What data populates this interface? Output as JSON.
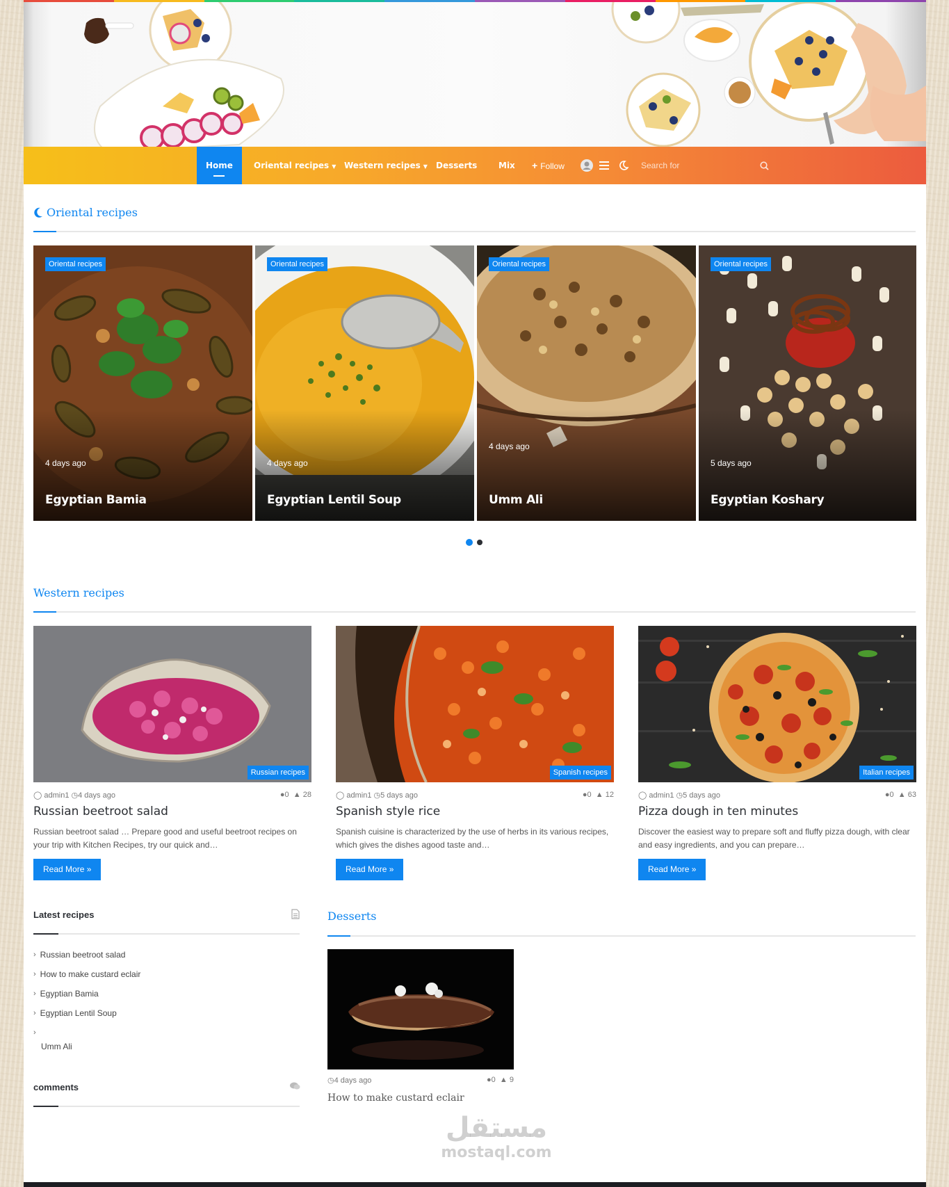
{
  "colors": {
    "accent": "#0f86f0",
    "nav_start": "#f6bf19",
    "nav_end": "#ec5b3e",
    "text": "#2c2f34",
    "strip": [
      "#e74c3c",
      "#f7ba1e",
      "#2ecc71",
      "#1abc9c",
      "#3498db",
      "#9b59b6",
      "#e91e63",
      "#ff9800",
      "#00bcd4",
      "#8e44ad"
    ]
  },
  "nav": {
    "items": [
      {
        "label": "Home",
        "active": true
      },
      {
        "label": "Oriental recipes",
        "dropdown": true
      },
      {
        "label": "Western recipes",
        "dropdown": true
      },
      {
        "label": "Desserts"
      },
      {
        "label": "Mix"
      }
    ],
    "follow_label": "Follow",
    "search_placeholder": "Search for",
    "icons": [
      "plus-icon",
      "user-avatar-icon",
      "menu-icon",
      "moon-icon",
      "search-icon"
    ]
  },
  "oriental": {
    "heading": "Oriental recipes",
    "slides": [
      {
        "category": "Oriental recipes",
        "date": "4 days ago",
        "title": "Egyptian Bamia"
      },
      {
        "category": "Oriental recipes",
        "date": "4 days ago",
        "title": "Egyptian Lentil Soup"
      },
      {
        "category": "Oriental recipes",
        "date": "4 days ago",
        "title": "Umm Ali"
      },
      {
        "category": "Oriental recipes",
        "date": "5 days ago",
        "title": "Egyptian Koshary"
      }
    ],
    "pager": {
      "pages": 2,
      "current": 1
    }
  },
  "western": {
    "heading": "Western recipes",
    "posts": [
      {
        "category": "Russian recipes",
        "author": "admin1",
        "date": "4 days ago",
        "comments": "0",
        "views": "28",
        "title": "Russian beetroot salad",
        "excerpt": "Russian beetroot salad … Prepare good and useful beetroot recipes on your trip with Kitchen Recipes, try our quick and…",
        "read_more": "Read More »"
      },
      {
        "category": "Spanish recipes",
        "author": "admin1",
        "date": "5 days ago",
        "comments": "0",
        "views": "12",
        "title": "Spanish style rice",
        "excerpt": "Spanish cuisine is characterized by the use of herbs in its various recipes, which gives the dishes agood taste and…",
        "read_more": "Read More »"
      },
      {
        "category": "Italian recipes",
        "author": "admin1",
        "date": "5 days ago",
        "comments": "0",
        "views": "63",
        "title": "Pizza dough in ten minutes",
        "excerpt": "Discover the easiest way to prepare soft and fluffy pizza dough, with clear and easy ingredients, and you can prepare…",
        "read_more": "Read More »"
      }
    ]
  },
  "sidebar": {
    "latest_title": "Latest recipes",
    "latest": [
      "Russian beetroot salad",
      "How to make custard eclair",
      "Egyptian Bamia",
      "Egyptian Lentil Soup",
      "Umm Ali"
    ],
    "comments_title": "comments"
  },
  "desserts": {
    "heading": "Desserts",
    "post": {
      "date": "4 days ago",
      "comments": "0",
      "views": "9",
      "title": "How to make custard eclair"
    }
  },
  "watermark": {
    "arabic": "مستقل",
    "latin": "mostaql.com"
  }
}
